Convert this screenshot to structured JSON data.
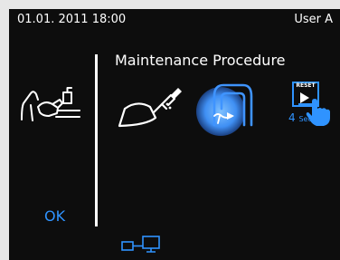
{
  "status_bar": {
    "datetime": "01.01. 2011 18:00",
    "user": "User A"
  },
  "title": "Maintenance Procedure",
  "reset_icon": {
    "label": "RESET",
    "duration_number": "4",
    "duration_unit": "Sec."
  },
  "ok_label": "OK",
  "icons": [
    "handpiece-holder-icon",
    "handpiece-spray-icon",
    "suction-hose-icon",
    "reset-hold-icon",
    "network-connection-icon"
  ],
  "colors": {
    "background": "#0d0d0d",
    "accent": "#2f93ff",
    "text": "#ffffff"
  }
}
